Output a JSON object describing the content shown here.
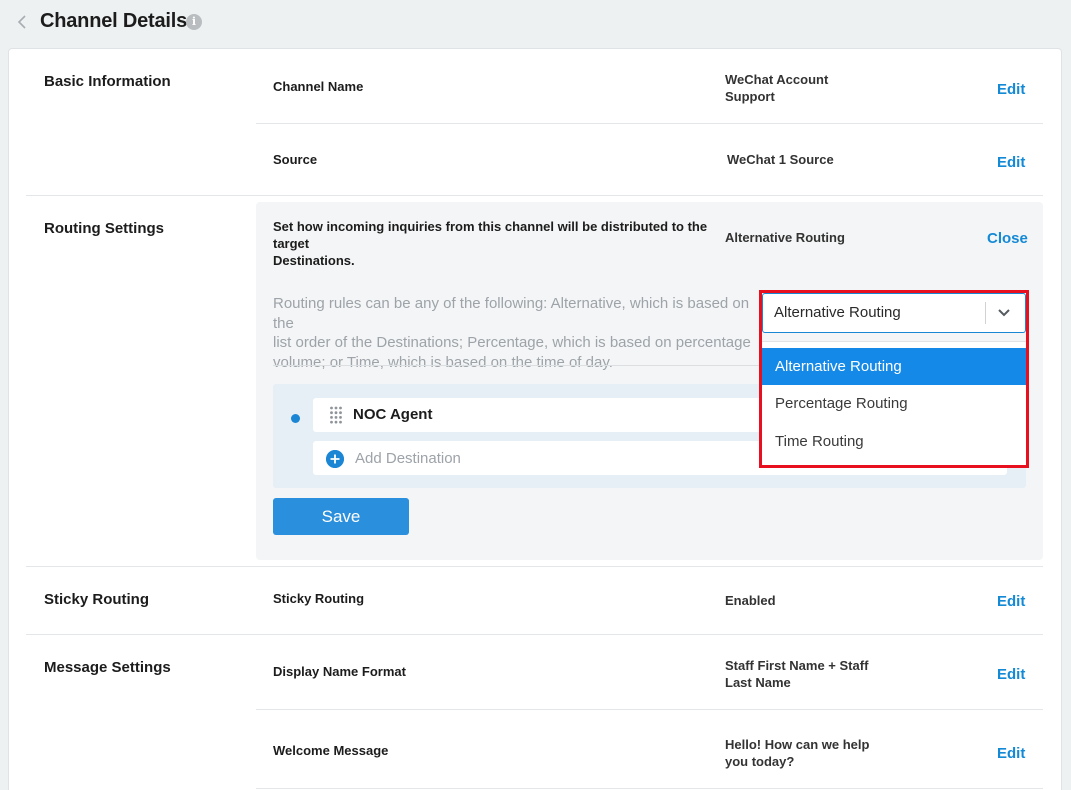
{
  "header": {
    "title": "Channel Details",
    "info_icon": "i"
  },
  "basic_information": {
    "section_label": "Basic Information",
    "fields": [
      {
        "label": "Channel Name",
        "value_line1": "WeChat Account",
        "value_line2": "Support",
        "action": "Edit"
      },
      {
        "label": "Source",
        "value": "WeChat 1 Source",
        "action": "Edit"
      }
    ]
  },
  "routing_settings": {
    "section_label": "Routing Settings",
    "intro_line1": "Set how incoming inquiries from this channel will be distributed to the target",
    "intro_line2": "Destinations.",
    "value": "Alternative Routing",
    "action": "Close",
    "description_line1": "Routing rules can be any of the following: Alternative, which is based on the",
    "description_line2": "list order of the Destinations; Percentage, which is based on percentage",
    "description_line3": "volume; or Time, which is based on the time of day.",
    "destination": "NOC Agent",
    "add_destination_placeholder": "Add Destination",
    "save_label": "Save",
    "select": {
      "selected": "Alternative Routing",
      "options": [
        "Alternative Routing",
        "Percentage Routing",
        "Time Routing"
      ]
    }
  },
  "sticky_routing": {
    "section_label": "Sticky Routing",
    "label": "Sticky Routing",
    "value": "Enabled",
    "action": "Edit"
  },
  "message_settings": {
    "section_label": "Message Settings",
    "fields": [
      {
        "label": "Display Name Format",
        "value_line1": "Staff First Name + Staff",
        "value_line2": "Last Name",
        "action": "Edit"
      },
      {
        "label": "Welcome Message",
        "value_line1": "Hello! How can we help",
        "value_line2": "you today?",
        "action": "Edit"
      }
    ]
  },
  "colors": {
    "accent": "#1489d6",
    "highlight_border": "#e8101e",
    "selected_option": "#1489e8"
  }
}
